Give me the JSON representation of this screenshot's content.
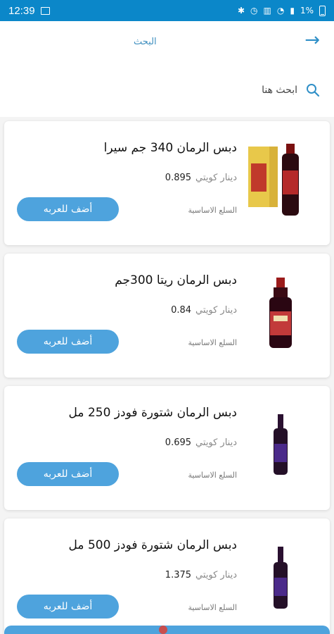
{
  "status_bar": {
    "time": "12:39",
    "battery": "1%"
  },
  "top_bar": {
    "title": "البحث"
  },
  "search": {
    "placeholder": "ابحث هنا"
  },
  "products": [
    {
      "name": "دبس الرمان 340 جم سيرا",
      "price": "0.895",
      "currency": "دينار كويتي",
      "category": "السلع الاساسية",
      "add_label": "أضف للعربه",
      "image": "product-box-and-bottle"
    },
    {
      "name": "دبس الرمان ريتا 300جم",
      "price": "0.84",
      "currency": "دينار كويتي",
      "category": "السلع الاساسية",
      "add_label": "أضف للعربه",
      "image": "product-bottle-red-label"
    },
    {
      "name": "دبس الرمان شتورة فودز 250 مل",
      "price": "0.695",
      "currency": "دينار كويتي",
      "category": "السلع الاساسية",
      "add_label": "أضف للعربه",
      "image": "product-bottle-purple-label"
    },
    {
      "name": "دبس الرمان شتورة فودز 500 مل",
      "price": "1.375",
      "currency": "دينار كويتي",
      "category": "السلع الاساسية",
      "add_label": "أضف للعربه",
      "image": "product-bottle-purple-label"
    }
  ],
  "colors": {
    "status_bar": "#0b87c9",
    "accent": "#4ea3dd",
    "title": "#3f8fbf"
  }
}
